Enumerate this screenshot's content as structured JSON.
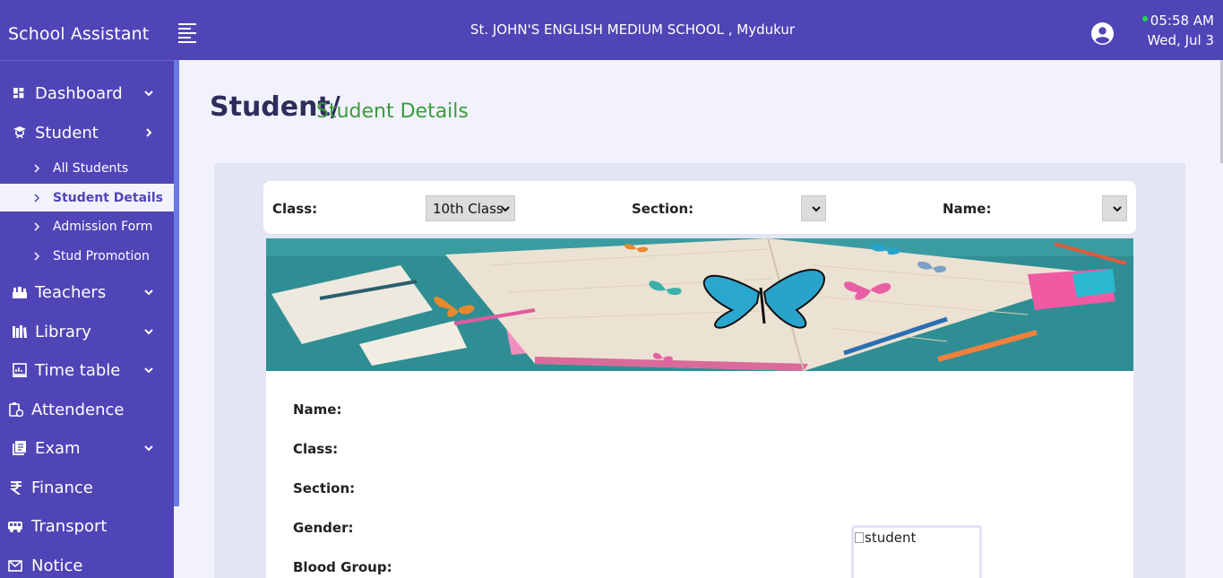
{
  "header": {
    "brand": "School Assistant",
    "school_name": "St. JOHN'S ENGLISH MEDIUM SCHOOL , Mydukur",
    "time": "05:58 AM",
    "date": "Wed, Jul 3",
    "menu_icon": "hamburger-icon",
    "user_icon": "user-circle-icon"
  },
  "sidebar": {
    "items": [
      {
        "label": "Dashboard",
        "icon": "dashboard-icon"
      },
      {
        "label": "Student",
        "icon": "graduate-icon"
      },
      {
        "label": "Teachers",
        "icon": "teachers-icon"
      },
      {
        "label": "Library",
        "icon": "library-icon"
      },
      {
        "label": "Time table",
        "icon": "timetable-icon"
      },
      {
        "label": "Attendence",
        "icon": "attendance-icon"
      },
      {
        "label": "Exam",
        "icon": "exam-icon"
      },
      {
        "label": "Finance",
        "icon": "rupee-icon"
      },
      {
        "label": "Transport",
        "icon": "bus-icon"
      },
      {
        "label": "Notice",
        "icon": "mail-icon"
      }
    ],
    "student_sub": [
      {
        "label": "All Students"
      },
      {
        "label": "Student Details"
      },
      {
        "label": "Admission Form"
      },
      {
        "label": "Stud Promotion"
      }
    ]
  },
  "page": {
    "title": "Student/",
    "subtitle": "Student Details"
  },
  "filters": {
    "class_label": "Class:",
    "class_value": "10th Class",
    "section_label": "Section:",
    "section_value": "",
    "name_label": "Name:",
    "name_value": ""
  },
  "details": {
    "fields": [
      "Name:",
      "Class:",
      "Section:",
      "Gender:",
      "Blood Group:"
    ],
    "photo_alt": "student"
  },
  "colors": {
    "primary": "#4f45b6",
    "accent_green": "#3a9b3c",
    "background": "#f1f2fb"
  }
}
